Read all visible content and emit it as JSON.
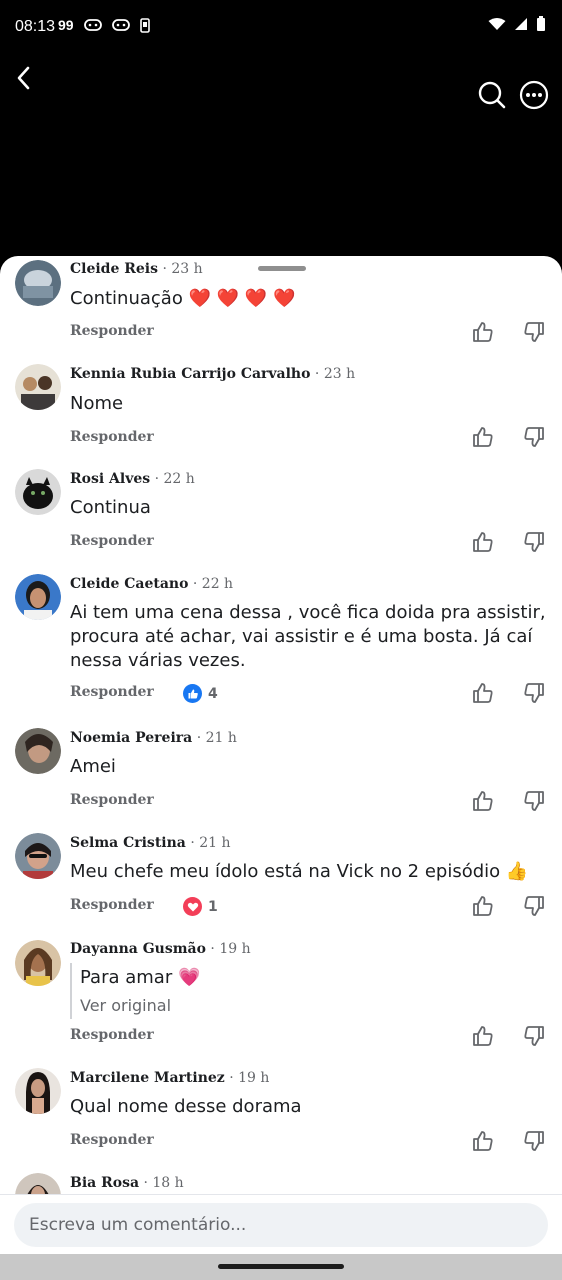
{
  "status_bar": {
    "time": "08:13",
    "badge": "99"
  },
  "composer": {
    "placeholder": "Escreva um comentário..."
  },
  "reply_label": "Responder",
  "comments": [
    {
      "author": "Cleide Reis",
      "time": "23 h",
      "text": "Continuação ❤️ ❤️ ❤️ ❤️"
    },
    {
      "author": "Kennia Rubia Carrijo Carvalho",
      "time": "23 h",
      "text": "Nome"
    },
    {
      "author": "Rosi Alves",
      "time": "22 h",
      "text": "Continua"
    },
    {
      "author": "Cleide Caetano",
      "time": "22 h",
      "text": "Ai tem uma cena dessa , você fica doida pra assistir, procura até achar, vai assistir e é uma bosta.  Já caí nessa várias vezes.",
      "reaction": {
        "type": "like",
        "count": "4",
        "color": "#1877f2"
      }
    },
    {
      "author": "Noemia Pereira",
      "time": "21 h",
      "text": "Amei"
    },
    {
      "author": "Selma Cristina",
      "time": "21 h",
      "text": "Meu chefe meu ídolo está na Vick no 2 episódio 👍",
      "reaction": {
        "type": "love",
        "count": "1",
        "color": "#f33e58"
      }
    },
    {
      "author": "Dayanna Gusmão",
      "time": "19 h",
      "text": "Para amar 💗",
      "see_original": "Ver original"
    },
    {
      "author": "Marcilene Martinez",
      "time": "19 h",
      "text": "Qual nome desse dorama"
    },
    {
      "author": "Bia Rosa",
      "time": "18 h"
    }
  ]
}
